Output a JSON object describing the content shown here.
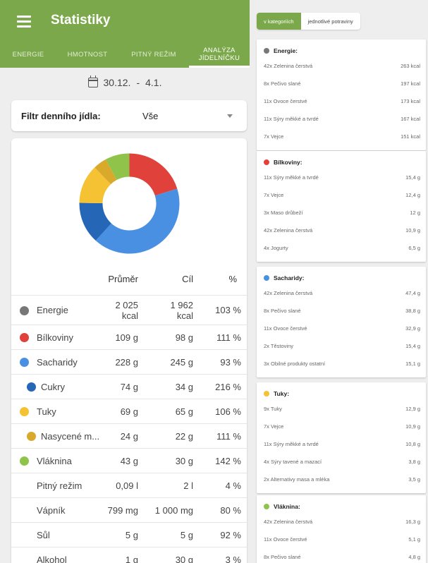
{
  "app": {
    "title": "Statistiky"
  },
  "tabs": [
    {
      "label": "ENERGIE"
    },
    {
      "label": "HMOTNOST"
    },
    {
      "label": "PITNÝ REŽIM"
    },
    {
      "label_line1": "ANALÝZA",
      "label_line2": "JÍDELNÍČKU"
    }
  ],
  "date_range": {
    "from": "30.12.",
    "sep": "-",
    "to": "4.1."
  },
  "filter": {
    "label": "Filtr denního jídla:",
    "value": "Vše"
  },
  "donut_segments": [
    {
      "name": "Bílkoviny",
      "value": 111,
      "color": "#e0413a"
    },
    {
      "name": "Sacharidy",
      "value": 228,
      "color": "#4a90e2"
    },
    {
      "name": "Cukry",
      "value": 74,
      "color": "#2566b6"
    },
    {
      "name": "Tuky",
      "value": 69,
      "color": "#f4c233"
    },
    {
      "name": "Nasycené mastné kyseliny",
      "value": 24,
      "color": "#d9a92c"
    },
    {
      "name": "Vláknina",
      "value": 43,
      "color": "#8fc34a"
    }
  ],
  "table": {
    "headers": {
      "avg": "Průměr",
      "goal": "Cíl",
      "pct": "%"
    },
    "rows": [
      {
        "name": "Energie",
        "avg1": "2 025",
        "avg2": "kcal",
        "goal1": "1 962",
        "goal2": "kcal",
        "pct": "103 %",
        "color": "#777777"
      },
      {
        "name": "Bílkoviny",
        "avg": "109 g",
        "goal": "98 g",
        "pct": "111 %",
        "color": "#e0413a"
      },
      {
        "name": "Sacharidy",
        "avg": "228 g",
        "goal": "245 g",
        "pct": "93 %",
        "color": "#4a90e2"
      },
      {
        "name": "Cukry",
        "avg": "74 g",
        "goal": "34 g",
        "pct": "216 %",
        "color": "#2566b6",
        "sub": true
      },
      {
        "name": "Tuky",
        "avg": "69 g",
        "goal": "65 g",
        "pct": "106 %",
        "color": "#f4c233"
      },
      {
        "name": "Nasycené m...",
        "avg": "24 g",
        "goal": "22 g",
        "pct": "111 %",
        "color": "#d9a92c",
        "sub": true
      },
      {
        "name": "Vláknina",
        "avg": "43 g",
        "goal": "30 g",
        "pct": "142 %",
        "color": "#8fc34a"
      },
      {
        "name": "Pitný režim",
        "avg": "0,09 l",
        "goal": "2 l",
        "pct": "4 %"
      },
      {
        "name": "Vápník",
        "avg": "799 mg",
        "goal": "1 000 mg",
        "pct": "80 %"
      },
      {
        "name": "Sůl",
        "avg": "5 g",
        "goal": "5 g",
        "pct": "92 %"
      },
      {
        "name": "Alkohol",
        "avg": "1 g",
        "goal": "30 g",
        "pct": "3 %"
      }
    ]
  },
  "right_tabs": [
    {
      "label": "v kategoriích"
    },
    {
      "label": "jednotlivé potraviny"
    }
  ],
  "right_cards": [
    {
      "title": "Energie:",
      "color": "#777777",
      "items": [
        {
          "t": "42x Zelenina čerstvá",
          "v": "263 kcal"
        },
        {
          "t": "8x Pečivo slané",
          "v": "197 kcal"
        },
        {
          "t": "11x Ovoce čerstvé",
          "v": "173 kcal"
        },
        {
          "t": "11x Sýry měkké a tvrdé",
          "v": "167 kcal"
        },
        {
          "t": "7x Vejce",
          "v": "151 kcal"
        }
      ]
    },
    {
      "title": "Bílkoviny:",
      "color": "#e0413a",
      "items": [
        {
          "t": "11x Sýry měkké a tvrdé",
          "v": "15,4 g"
        },
        {
          "t": "7x Vejce",
          "v": "12,4 g"
        },
        {
          "t": "3x Maso drůbeží",
          "v": "12 g"
        },
        {
          "t": "42x Zelenina čerstvá",
          "v": "10,9 g"
        },
        {
          "t": "4x Jogurty",
          "v": "6,5 g"
        }
      ]
    },
    {
      "title": "Sacharidy:",
      "color": "#4a90e2",
      "items": [
        {
          "t": "42x Zelenina čerstvá",
          "v": "47,4 g"
        },
        {
          "t": "8x Pečivo slané",
          "v": "38,8 g"
        },
        {
          "t": "11x Ovoce čerstvé",
          "v": "32,9 g"
        },
        {
          "t": "2x Těstoviny",
          "v": "15,4 g"
        },
        {
          "t": "3x Obilné produkty ostatní",
          "v": "15,1 g"
        }
      ]
    },
    {
      "title": "Tuky:",
      "color": "#f4c233",
      "items": [
        {
          "t": "9x Tuky",
          "v": "12,9 g"
        },
        {
          "t": "7x Vejce",
          "v": "10,9 g"
        },
        {
          "t": "11x Sýry měkké a tvrdé",
          "v": "10,8 g"
        },
        {
          "t": "4x Sýry tavené a mazací",
          "v": "3,8 g"
        },
        {
          "t": "2x Alternativy masa a mléka",
          "v": "3,5 g"
        }
      ]
    },
    {
      "title": "Vláknina:",
      "color": "#8fc34a",
      "items": [
        {
          "t": "42x Zelenina čerstvá",
          "v": "16,3 g"
        },
        {
          "t": "11x Ovoce čerstvé",
          "v": "5,1 g"
        },
        {
          "t": "8x Pečivo slané",
          "v": "4,8 g"
        }
      ]
    }
  ]
}
